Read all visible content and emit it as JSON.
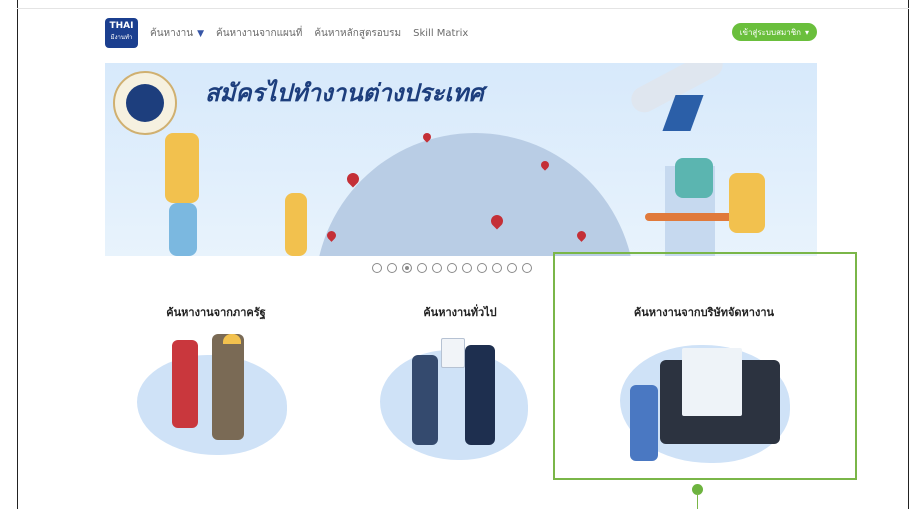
{
  "nav": {
    "logo_text": "THAI",
    "logo_sub": "มีงานทำ",
    "items": [
      {
        "label": "ค้นหางาน",
        "has_caret": true
      },
      {
        "label": "ค้นหางานจากแผนที่"
      },
      {
        "label": "ค้นหาหลักสูตรอบรม"
      },
      {
        "label": "Skill Matrix"
      }
    ],
    "member_button": "เข้าสู่ระบบสมาชิก"
  },
  "banner": {
    "title": "สมัครไปทำงานต่างประเทศ",
    "seal_label": "กรมการจัดหางาน"
  },
  "carousel": {
    "total_slides": 11,
    "active_index": 2
  },
  "cards": [
    {
      "title": "ค้นหางานจากภาครัฐ"
    },
    {
      "title": "ค้นหางานทั่วไป"
    },
    {
      "title": "ค้นหางานจากบริษัทจัดหางาน"
    }
  ],
  "colors": {
    "highlight": "#7ab648",
    "member_button": "#6abf3c",
    "brand_blue": "#1d3e7d"
  }
}
